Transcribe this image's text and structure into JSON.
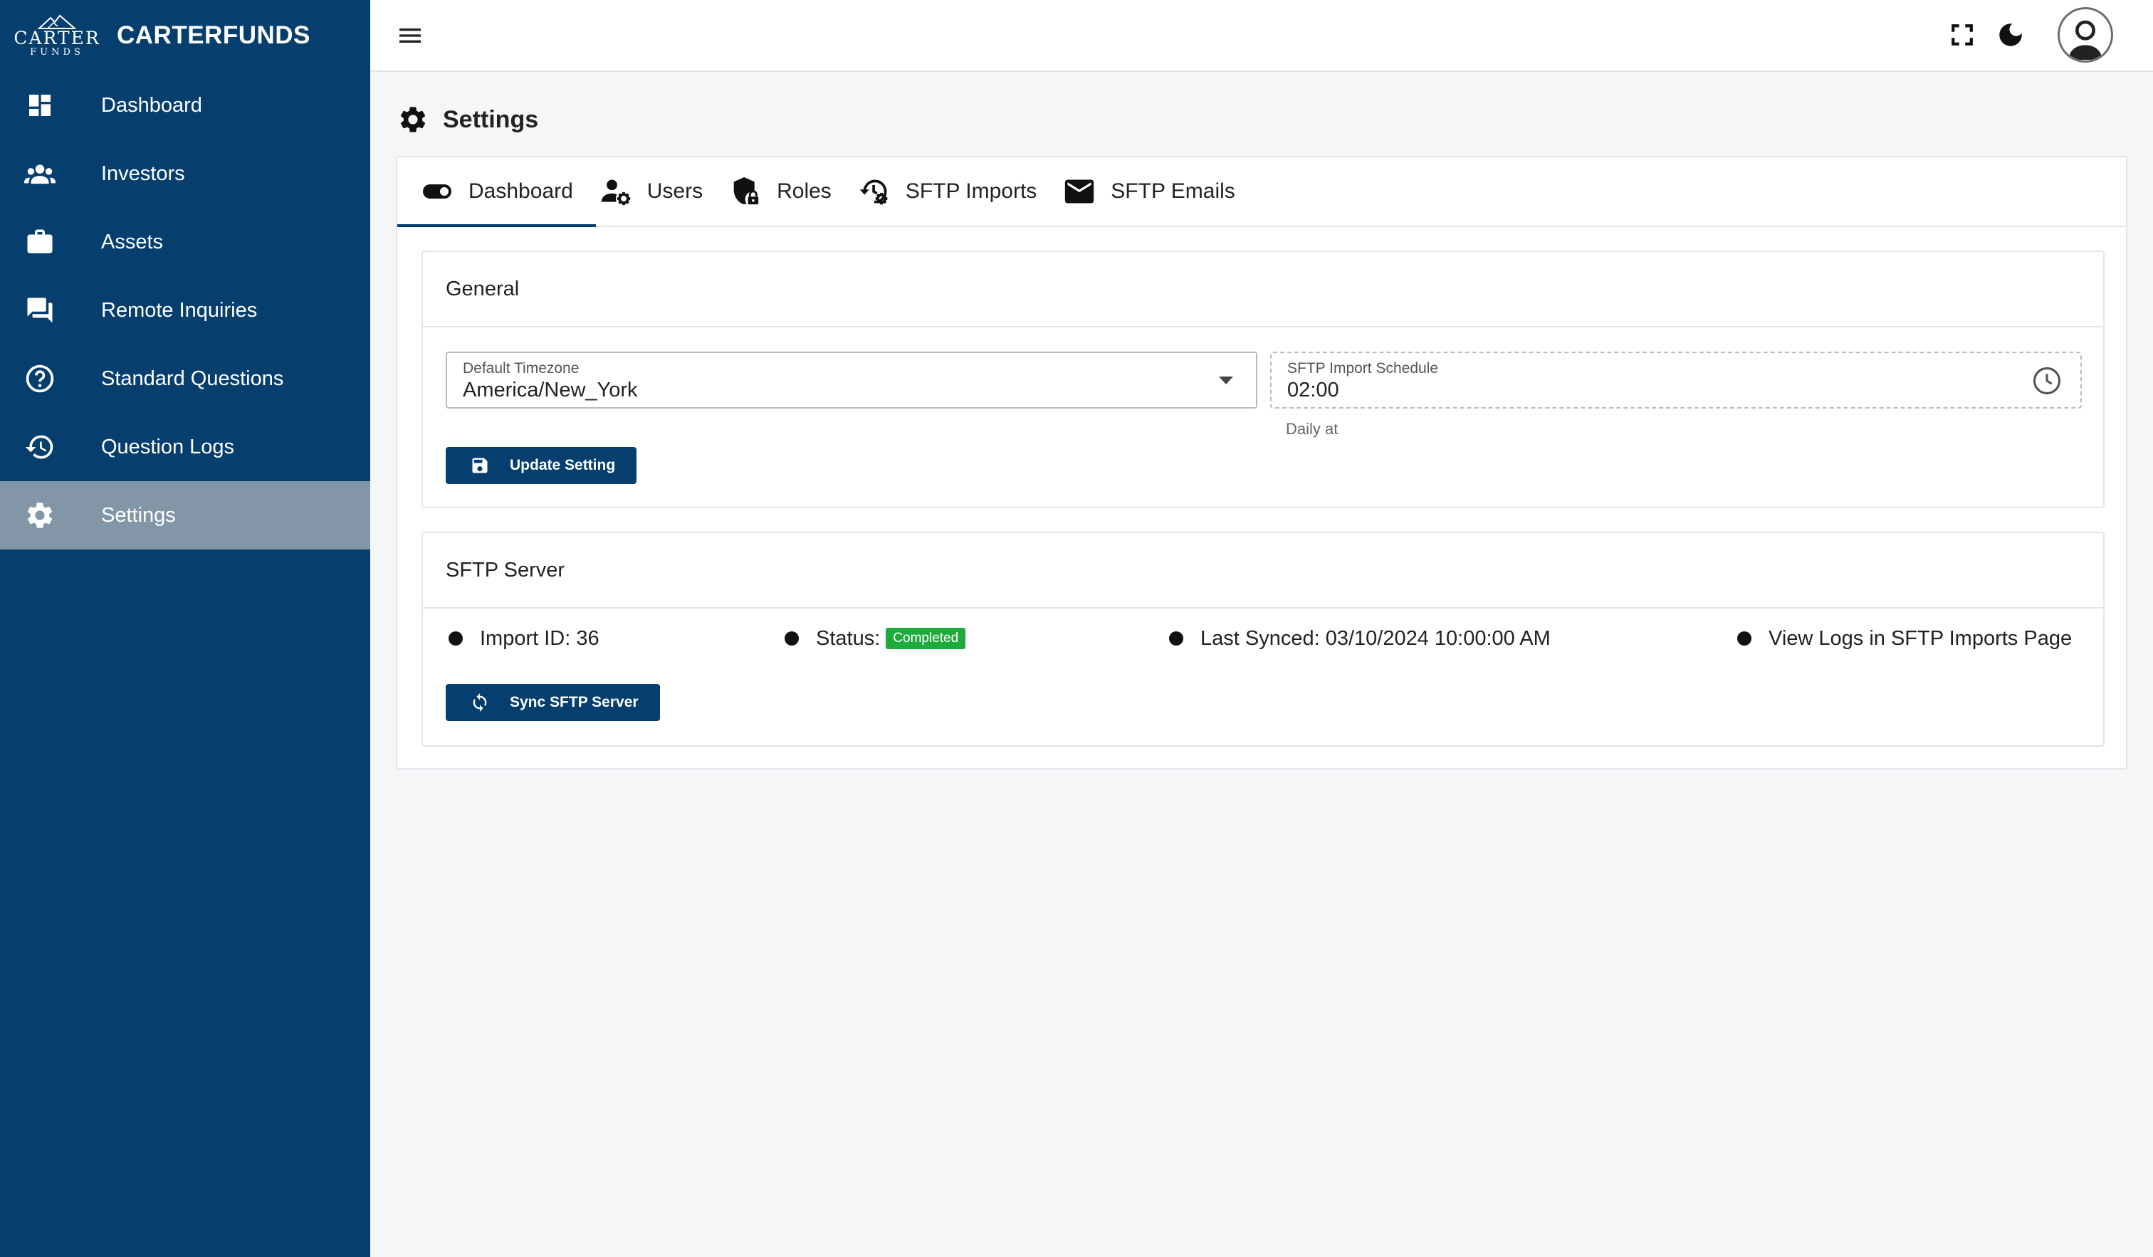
{
  "brand": {
    "logo_top": "CARTER",
    "logo_bottom": "FUNDS",
    "name": "CARTERFUNDS"
  },
  "sidebar": {
    "items": [
      {
        "label": "Dashboard",
        "icon": "dashboard-icon"
      },
      {
        "label": "Investors",
        "icon": "people-icon"
      },
      {
        "label": "Assets",
        "icon": "briefcase-icon"
      },
      {
        "label": "Remote Inquiries",
        "icon": "chat-icon"
      },
      {
        "label": "Standard Questions",
        "icon": "help-circle-icon"
      },
      {
        "label": "Question Logs",
        "icon": "history-icon"
      },
      {
        "label": "Settings",
        "icon": "gear-icon",
        "active": true
      }
    ]
  },
  "topbar": {
    "icons": [
      "menu-icon",
      "fullscreen-icon",
      "dark-mode-icon",
      "avatar"
    ]
  },
  "page": {
    "title": "Settings"
  },
  "tabs": [
    {
      "label": "Dashboard",
      "icon": "toggle-icon",
      "active": true
    },
    {
      "label": "Users",
      "icon": "user-gear-icon"
    },
    {
      "label": "Roles",
      "icon": "shield-lock-icon"
    },
    {
      "label": "SFTP Imports",
      "icon": "history-gear-icon"
    },
    {
      "label": "SFTP Emails",
      "icon": "mail-icon"
    }
  ],
  "general": {
    "title": "General",
    "timezone": {
      "label": "Default Timezone",
      "value": "America/New_York"
    },
    "schedule": {
      "label": "SFTP Import Schedule",
      "value": "02:00",
      "helper": "Daily at"
    },
    "update_button": "Update Setting"
  },
  "sftp": {
    "title": "SFTP Server",
    "import_id": "Import ID: 36",
    "status_label": "Status:",
    "status_value": "Completed",
    "last_synced": "Last Synced: 03/10/2024 10:00:00 AM",
    "view_logs": "View Logs in SFTP Imports Page",
    "sync_button": "Sync SFTP Server"
  },
  "colors": {
    "sidebar": "#063f6e",
    "sidebar_active": "#8396a8",
    "primary": "#063f6e",
    "status_completed": "#1faa3c"
  }
}
